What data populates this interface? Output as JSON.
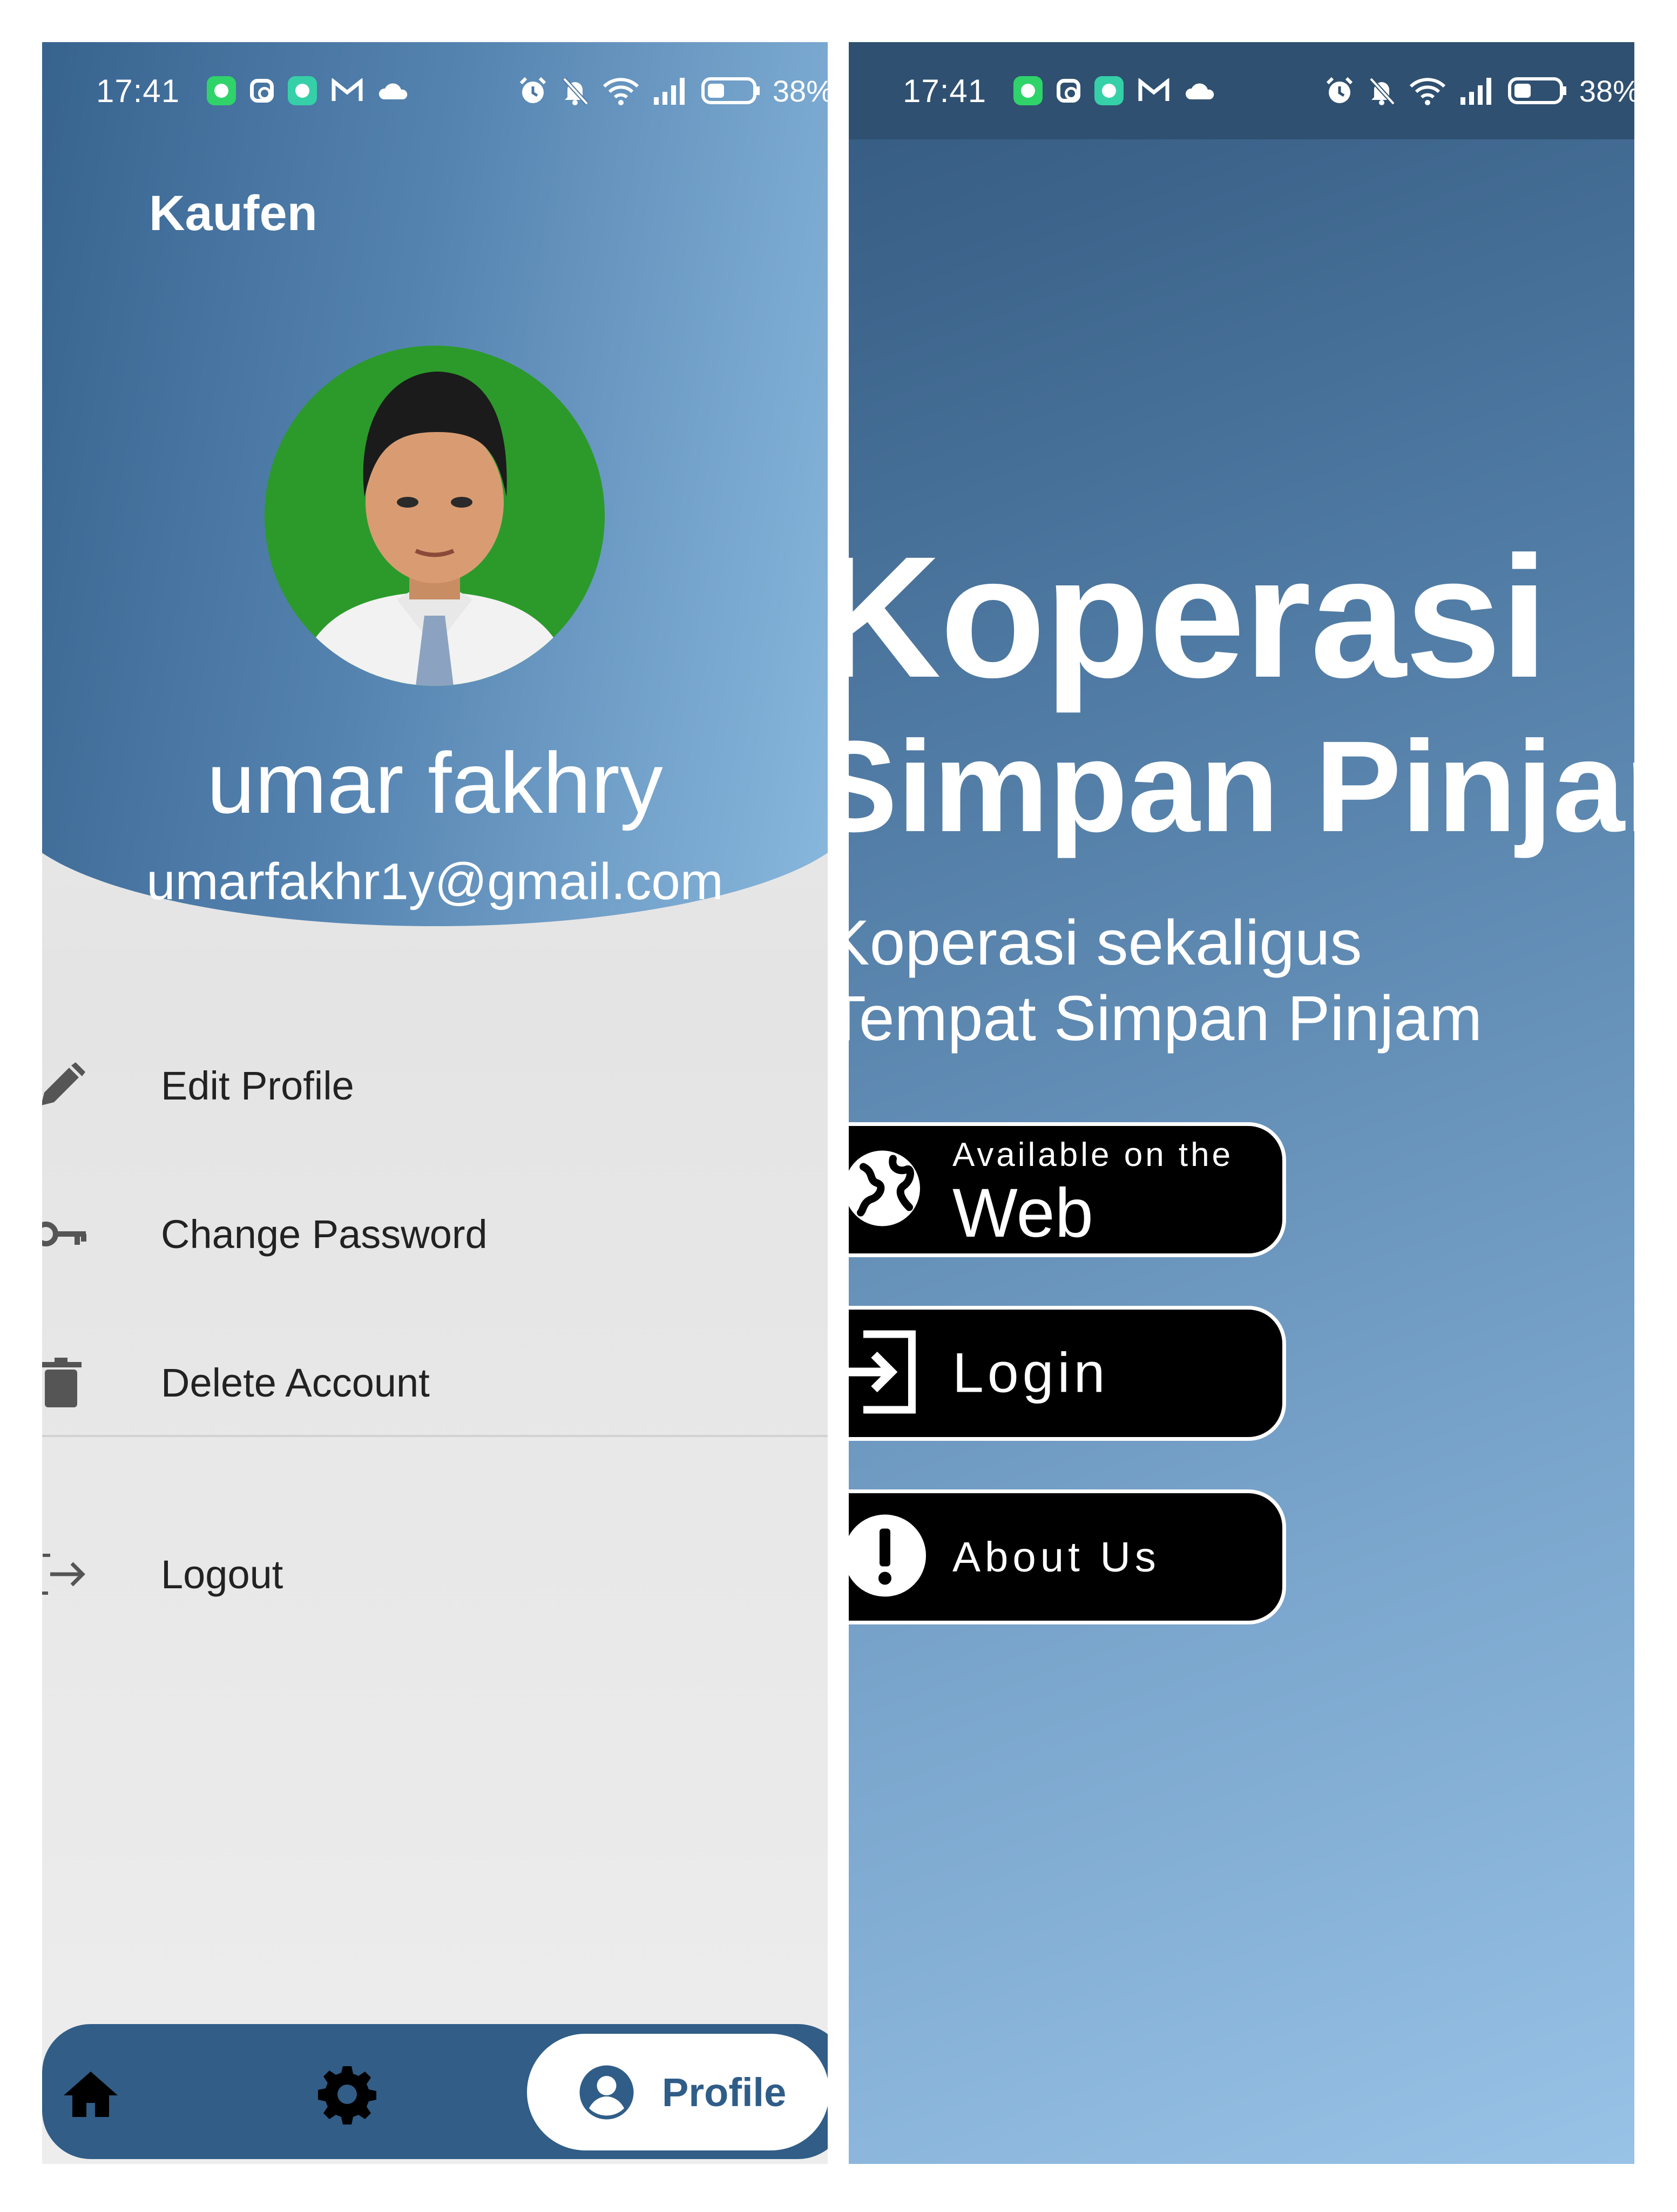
{
  "status_bar": {
    "time": "17:41",
    "battery": "38%"
  },
  "profile_screen": {
    "app_title": "Kaufen",
    "user": {
      "name": "umar fakhry",
      "email": "umarfakhr1y@gmail.com"
    },
    "menu": {
      "edit_profile": "Edit Profile",
      "change_password": "Change Password",
      "delete_account": "Delete Account",
      "logout": "Logout"
    },
    "bottom_nav": {
      "active_label": "Profile"
    }
  },
  "landing_screen": {
    "title_line1": "Koperasi",
    "title_line2": "Simpan Pinjam",
    "subtitle_line1": "Koperasi sekaligus",
    "subtitle_line2": "Tempat Simpan Pinjam",
    "web_button": {
      "small": "Available on the",
      "big": "Web"
    },
    "login_button": "Login",
    "about_button": "About Us"
  },
  "colors": {
    "header_dark": "#35608c",
    "header_light": "#8cbbe0",
    "nav_bar": "#315d87",
    "button_bg": "#000000"
  },
  "icons": {
    "profile_menu": [
      "pencil-icon",
      "key-icon",
      "trash-icon",
      "logout-icon"
    ],
    "bottom_nav": [
      "home-icon",
      "gear-icon",
      "account-circle-icon"
    ],
    "landing_buttons": [
      "globe-icon",
      "login-icon",
      "exclamation-icon"
    ]
  }
}
